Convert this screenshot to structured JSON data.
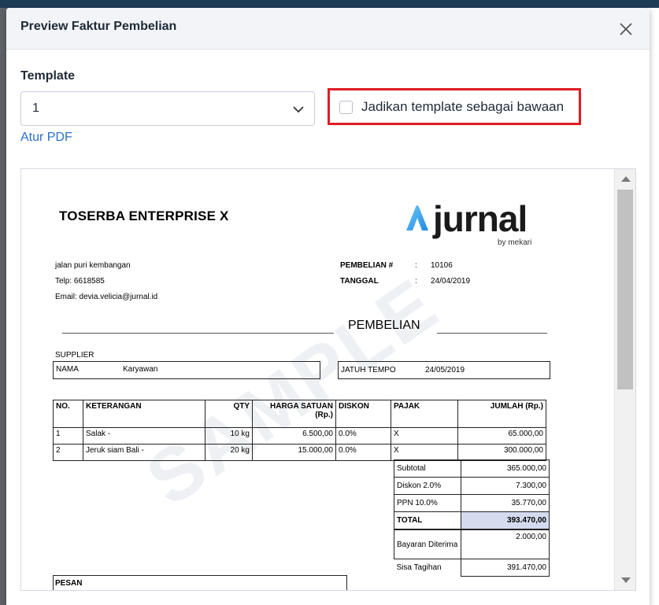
{
  "modal": {
    "title": "Preview Faktur Pembelian",
    "template_label": "Template",
    "template_value": "1",
    "default_checkbox_label": "Jadikan template sebagai bawaan",
    "default_checked": false,
    "atur_pdf_link": "Atur PDF"
  },
  "accent_colors": {
    "link": "#2a70c8",
    "highlight_border": "#e01c24"
  },
  "invoice": {
    "company": "TOSERBA ENTERPRISE X",
    "logo_text": "jurnal",
    "logo_sub": "by mekari",
    "address": "jalan puri kembangan",
    "phone": "Telp: 6618585",
    "email": "Email: devia.velicia@jurnal.id",
    "pembelian_label": "PEMBELIAN #",
    "pembelian_no": "10106",
    "tanggal_label": "TANGGAL",
    "tanggal": "24/04/2019",
    "colon": ":",
    "section_title": "PEMBELIAN",
    "supplier_label": "SUPPLIER",
    "nama_label": "NAMA",
    "nama_value": "Karyawan",
    "jatuh_tempo_label": "JATUH TEMPO",
    "jatuh_tempo": "24/05/2019",
    "watermark": "SAMPLE",
    "headers": {
      "no": "NO.",
      "keterangan": "KETERANGAN",
      "qty": "QTY",
      "harga": "HARGA SATUAN (Rp.)",
      "diskon": "DISKON",
      "pajak": "PAJAK",
      "jumlah": "JUMLAH (Rp.)"
    },
    "rows": [
      {
        "no": "1",
        "keterangan": "Salak -",
        "qty": "10 kg",
        "harga": "6.500,00",
        "diskon": "0.0%",
        "pajak": "X",
        "jumlah": "65.000,00"
      },
      {
        "no": "2",
        "keterangan": "Jeruk siam Bali -",
        "qty": "20 kg",
        "harga": "15.000,00",
        "diskon": "0.0%",
        "pajak": "X",
        "jumlah": "300.000,00"
      }
    ],
    "summary": {
      "subtotal_label": "Subtotal",
      "subtotal": "365.000,00",
      "diskon_label": "Diskon 2.0%",
      "diskon": "7.300,00",
      "ppn_label": "PPN 10.0%",
      "ppn": "35.770,00",
      "total_label": "TOTAL",
      "total": "393.470,00",
      "bayaran_label": "Bayaran Diterima",
      "bayaran": "2.000,00",
      "sisa_label": "Sisa Tagihan",
      "sisa": "391.470,00"
    },
    "pesan_label": "PESAN"
  }
}
